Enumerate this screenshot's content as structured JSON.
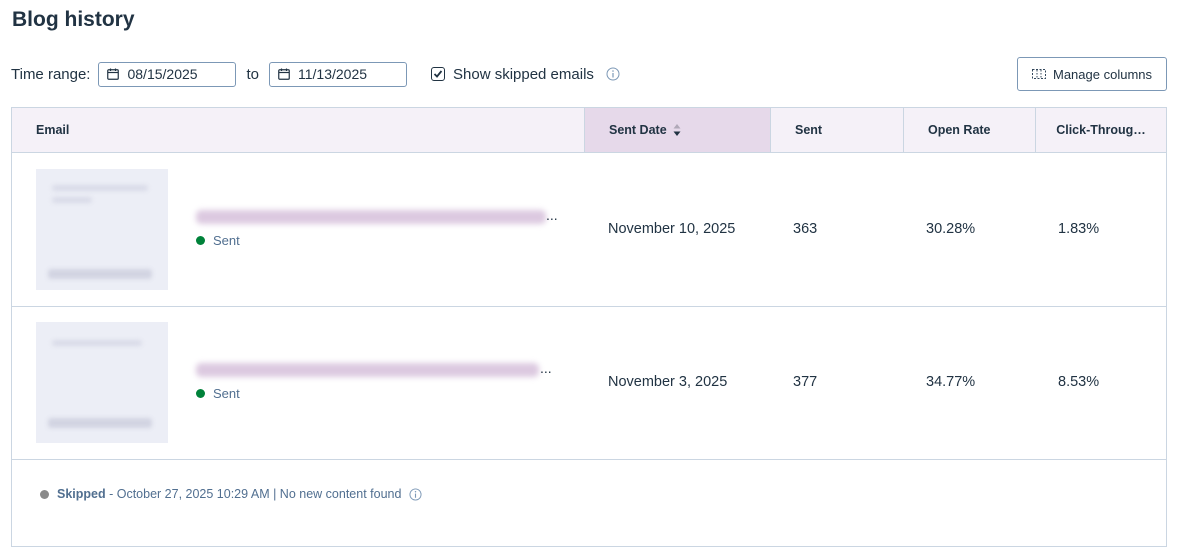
{
  "page": {
    "title": "Blog history"
  },
  "filters": {
    "time_range_label": "Time range:",
    "start_date": "08/15/2025",
    "to_label": "to",
    "end_date": "11/13/2025",
    "show_skipped_label": "Show skipped emails",
    "show_skipped_checked": true
  },
  "toolbar": {
    "manage_columns_label": "Manage columns"
  },
  "table": {
    "columns": [
      "Email",
      "Sent Date",
      "Sent",
      "Open Rate",
      "Click-Throug…"
    ],
    "sorted_column": "Sent Date",
    "rows": [
      {
        "status": "Sent",
        "status_color": "#00823a",
        "sent_date": "November 10, 2025",
        "sent": "363",
        "open_rate": "30.28%",
        "click_through": "1.83%"
      },
      {
        "status": "Sent",
        "status_color": "#00823a",
        "sent_date": "November 3, 2025",
        "sent": "377",
        "open_rate": "34.77%",
        "click_through": "8.53%"
      }
    ],
    "skipped": {
      "status": "Skipped",
      "status_color": "#8a8a8a",
      "detail": " - October 27, 2025 10:29 AM | No new content found"
    },
    "ellipsis": "..."
  },
  "icons": [
    "calendar-icon",
    "checkbox-check-icon",
    "info-icon",
    "manage-columns-icon",
    "sort-icon"
  ],
  "colors": {
    "header_bg": "#f5f1f8",
    "sorted_header_bg": "#e6d9ea",
    "border": "#cbd6e2",
    "text": "#213343"
  }
}
